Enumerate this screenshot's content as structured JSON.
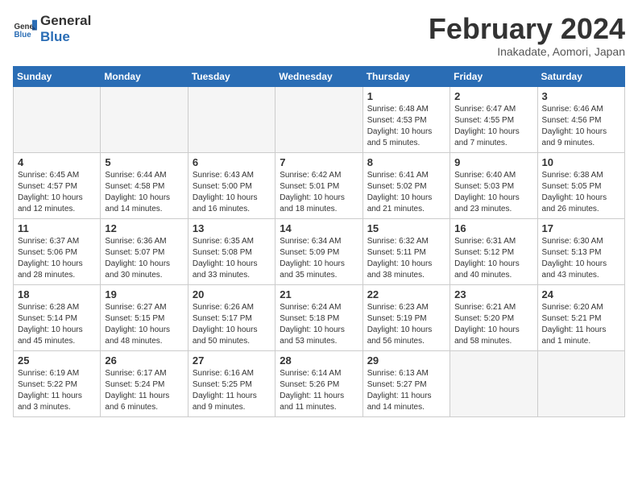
{
  "logo": {
    "text_general": "General",
    "text_blue": "Blue"
  },
  "header": {
    "title": "February 2024",
    "subtitle": "Inakadate, Aomori, Japan"
  },
  "weekdays": [
    "Sunday",
    "Monday",
    "Tuesday",
    "Wednesday",
    "Thursday",
    "Friday",
    "Saturday"
  ],
  "weeks": [
    [
      {
        "day": "",
        "info": ""
      },
      {
        "day": "",
        "info": ""
      },
      {
        "day": "",
        "info": ""
      },
      {
        "day": "",
        "info": ""
      },
      {
        "day": "1",
        "info": "Sunrise: 6:48 AM\nSunset: 4:53 PM\nDaylight: 10 hours\nand 5 minutes."
      },
      {
        "day": "2",
        "info": "Sunrise: 6:47 AM\nSunset: 4:55 PM\nDaylight: 10 hours\nand 7 minutes."
      },
      {
        "day": "3",
        "info": "Sunrise: 6:46 AM\nSunset: 4:56 PM\nDaylight: 10 hours\nand 9 minutes."
      }
    ],
    [
      {
        "day": "4",
        "info": "Sunrise: 6:45 AM\nSunset: 4:57 PM\nDaylight: 10 hours\nand 12 minutes."
      },
      {
        "day": "5",
        "info": "Sunrise: 6:44 AM\nSunset: 4:58 PM\nDaylight: 10 hours\nand 14 minutes."
      },
      {
        "day": "6",
        "info": "Sunrise: 6:43 AM\nSunset: 5:00 PM\nDaylight: 10 hours\nand 16 minutes."
      },
      {
        "day": "7",
        "info": "Sunrise: 6:42 AM\nSunset: 5:01 PM\nDaylight: 10 hours\nand 18 minutes."
      },
      {
        "day": "8",
        "info": "Sunrise: 6:41 AM\nSunset: 5:02 PM\nDaylight: 10 hours\nand 21 minutes."
      },
      {
        "day": "9",
        "info": "Sunrise: 6:40 AM\nSunset: 5:03 PM\nDaylight: 10 hours\nand 23 minutes."
      },
      {
        "day": "10",
        "info": "Sunrise: 6:38 AM\nSunset: 5:05 PM\nDaylight: 10 hours\nand 26 minutes."
      }
    ],
    [
      {
        "day": "11",
        "info": "Sunrise: 6:37 AM\nSunset: 5:06 PM\nDaylight: 10 hours\nand 28 minutes."
      },
      {
        "day": "12",
        "info": "Sunrise: 6:36 AM\nSunset: 5:07 PM\nDaylight: 10 hours\nand 30 minutes."
      },
      {
        "day": "13",
        "info": "Sunrise: 6:35 AM\nSunset: 5:08 PM\nDaylight: 10 hours\nand 33 minutes."
      },
      {
        "day": "14",
        "info": "Sunrise: 6:34 AM\nSunset: 5:09 PM\nDaylight: 10 hours\nand 35 minutes."
      },
      {
        "day": "15",
        "info": "Sunrise: 6:32 AM\nSunset: 5:11 PM\nDaylight: 10 hours\nand 38 minutes."
      },
      {
        "day": "16",
        "info": "Sunrise: 6:31 AM\nSunset: 5:12 PM\nDaylight: 10 hours\nand 40 minutes."
      },
      {
        "day": "17",
        "info": "Sunrise: 6:30 AM\nSunset: 5:13 PM\nDaylight: 10 hours\nand 43 minutes."
      }
    ],
    [
      {
        "day": "18",
        "info": "Sunrise: 6:28 AM\nSunset: 5:14 PM\nDaylight: 10 hours\nand 45 minutes."
      },
      {
        "day": "19",
        "info": "Sunrise: 6:27 AM\nSunset: 5:15 PM\nDaylight: 10 hours\nand 48 minutes."
      },
      {
        "day": "20",
        "info": "Sunrise: 6:26 AM\nSunset: 5:17 PM\nDaylight: 10 hours\nand 50 minutes."
      },
      {
        "day": "21",
        "info": "Sunrise: 6:24 AM\nSunset: 5:18 PM\nDaylight: 10 hours\nand 53 minutes."
      },
      {
        "day": "22",
        "info": "Sunrise: 6:23 AM\nSunset: 5:19 PM\nDaylight: 10 hours\nand 56 minutes."
      },
      {
        "day": "23",
        "info": "Sunrise: 6:21 AM\nSunset: 5:20 PM\nDaylight: 10 hours\nand 58 minutes."
      },
      {
        "day": "24",
        "info": "Sunrise: 6:20 AM\nSunset: 5:21 PM\nDaylight: 11 hours\nand 1 minute."
      }
    ],
    [
      {
        "day": "25",
        "info": "Sunrise: 6:19 AM\nSunset: 5:22 PM\nDaylight: 11 hours\nand 3 minutes."
      },
      {
        "day": "26",
        "info": "Sunrise: 6:17 AM\nSunset: 5:24 PM\nDaylight: 11 hours\nand 6 minutes."
      },
      {
        "day": "27",
        "info": "Sunrise: 6:16 AM\nSunset: 5:25 PM\nDaylight: 11 hours\nand 9 minutes."
      },
      {
        "day": "28",
        "info": "Sunrise: 6:14 AM\nSunset: 5:26 PM\nDaylight: 11 hours\nand 11 minutes."
      },
      {
        "day": "29",
        "info": "Sunrise: 6:13 AM\nSunset: 5:27 PM\nDaylight: 11 hours\nand 14 minutes."
      },
      {
        "day": "",
        "info": ""
      },
      {
        "day": "",
        "info": ""
      }
    ]
  ]
}
